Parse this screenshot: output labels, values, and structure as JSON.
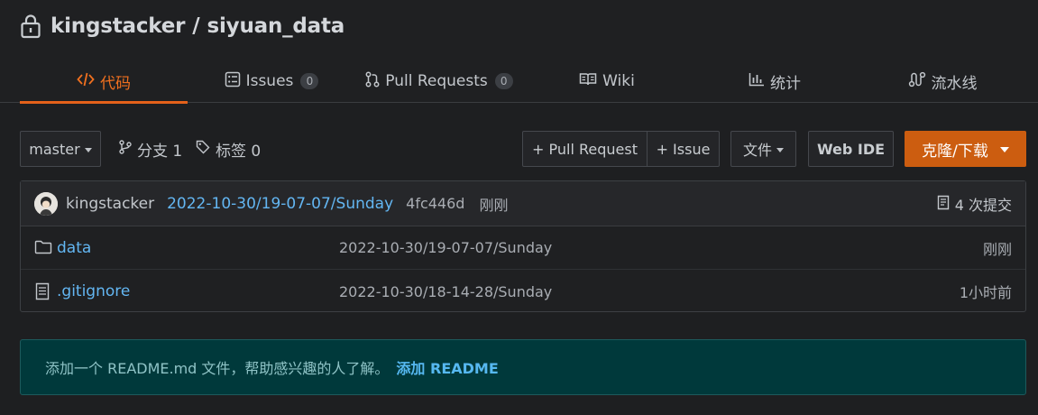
{
  "repo": {
    "owner": "kingstacker",
    "separator": "/",
    "name": "siyuan_data"
  },
  "tabs": [
    {
      "label": "代码",
      "icon": "code-icon",
      "active": true
    },
    {
      "label": "Issues",
      "icon": "issues-icon",
      "count": "0"
    },
    {
      "label": "Pull Requests",
      "icon": "pull-request-icon",
      "count": "0"
    },
    {
      "label": "Wiki",
      "icon": "book-icon"
    },
    {
      "label": "统计",
      "icon": "bar-chart-icon"
    },
    {
      "label": "流水线",
      "icon": "pipeline-icon"
    }
  ],
  "toolbar": {
    "branch": "master",
    "branches_label": "分支 1",
    "tags_label": "标签 0",
    "new_pr": "+ Pull Request",
    "new_issue": "+ Issue",
    "file_menu": "文件",
    "web_ide": "Web IDE",
    "clone": "克隆/下载"
  },
  "latest_commit": {
    "author": "kingstacker",
    "message": "2022-10-30/19-07-07/Sunday",
    "sha": "4fc446d",
    "time": "刚刚",
    "commit_count_label": "4 次提交"
  },
  "files": [
    {
      "name": "data",
      "type": "folder",
      "message": "2022-10-30/19-07-07/Sunday",
      "time": "刚刚"
    },
    {
      "name": ".gitignore",
      "type": "file",
      "message": "2022-10-30/18-14-28/Sunday",
      "time": "1小时前"
    }
  ],
  "readme_banner": {
    "text": "添加一个 README.md 文件，帮助感兴趣的人了解。",
    "link": "添加 README"
  },
  "colors": {
    "accent": "#e4611a",
    "link": "#63b6f2",
    "background": "#1e1f21",
    "banner": "#00393b"
  }
}
